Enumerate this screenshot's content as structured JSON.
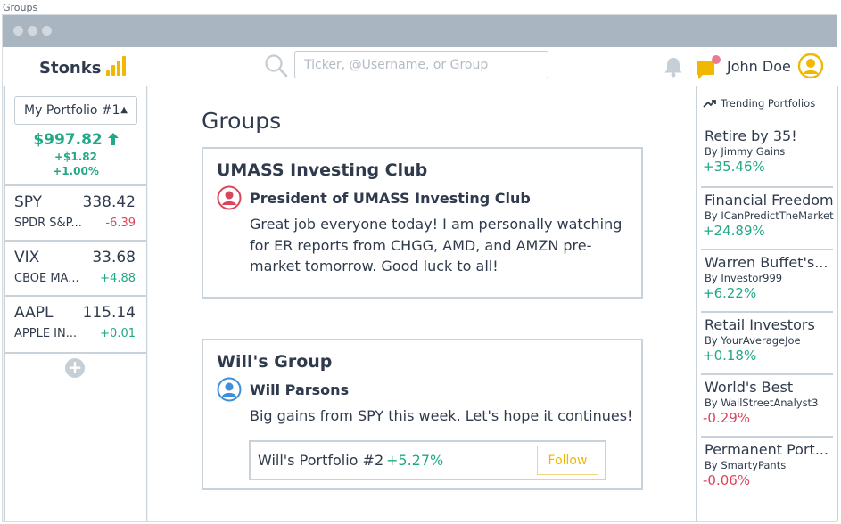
{
  "window": {
    "label": "Groups"
  },
  "header": {
    "logo": "Stonks",
    "search_placeholder": "Ticker, @Username, or Group",
    "user_name": "John Doe"
  },
  "portfolio": {
    "selected": "My Portfolio #1",
    "value": "$997.82",
    "change_abs": "+$1.82",
    "change_pct": "+1.00%"
  },
  "watchlist": [
    {
      "ticker": "SPY",
      "price": "338.42",
      "name": "SPDR S&P...",
      "change": "-6.39",
      "trend": "neg"
    },
    {
      "ticker": "VIX",
      "price": "33.68",
      "name": "CBOE MA...",
      "change": "+4.88",
      "trend": "pos"
    },
    {
      "ticker": "AAPL",
      "price": "115.14",
      "name": "APPLE IN...",
      "change": "+0.01",
      "trend": "pos"
    }
  ],
  "main": {
    "title": "Groups",
    "groups": [
      {
        "name": "UMASS Investing Club",
        "author": "President of UMASS Investing Club",
        "text": "Great job everyone today! I am personally watching for ER reports from CHGG, AMD, and AMZN pre-market tomorrow. Good luck to all!"
      },
      {
        "name": "Will's Group",
        "author": "Will Parsons",
        "text": "Big gains from SPY this week. Let's hope it continues!",
        "shared_portfolio": {
          "name": "Will's Portfolio #2",
          "change": "+5.27%",
          "follow_label": "Follow"
        }
      }
    ]
  },
  "trending": {
    "title": "Trending Portfolios",
    "items": [
      {
        "name": "Retire by 35!",
        "by": "By Jimmy Gains",
        "change": "+35.46%",
        "trend": "pos"
      },
      {
        "name": "Financial Freedom",
        "by": "By ICanPredictTheMarket",
        "change": "+24.89%",
        "trend": "pos"
      },
      {
        "name": "Warren Buffet's...",
        "by": "By Investor999",
        "change": "+6.22%",
        "trend": "pos"
      },
      {
        "name": "Retail Investors",
        "by": "By YourAverageJoe",
        "change": "+0.18%",
        "trend": "pos"
      },
      {
        "name": "World's Best",
        "by": "By WallStreetAnalyst3",
        "change": "-0.29%",
        "trend": "neg"
      },
      {
        "name": "Permanent Port...",
        "by": "By SmartyPants",
        "change": "-0.06%",
        "trend": "neg"
      }
    ]
  },
  "colors": {
    "positive": "#22a886",
    "negative": "#d8465b",
    "accent": "#f0b800",
    "author_red": "#d8465b",
    "author_blue": "#3d8fd8"
  }
}
